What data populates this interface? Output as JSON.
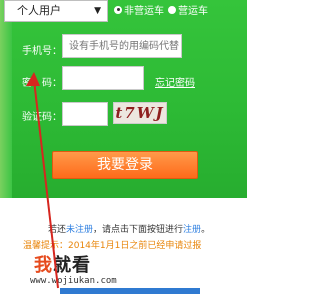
{
  "login": {
    "user_type": "个人用户",
    "radio_options": [
      {
        "label": "非营运车",
        "checked": true
      },
      {
        "label": "营运车",
        "checked": false
      }
    ],
    "phone_label": "手机号：",
    "phone_placeholder": "设有手机号的用编码代替",
    "password_label": "密　码：",
    "forgot_label": "忘记密码",
    "captcha_label": "验证码：",
    "captcha_text": "t7WJ",
    "submit_label": "我要登录"
  },
  "notice": {
    "register_pre": "若还",
    "register_em1": "未注册",
    "register_mid": "，请点击下面按钮进行",
    "register_em2": "注册",
    "register_post": "。",
    "hint": "温馨提示：2014年1月1日之前已经申请过报"
  },
  "watermark": {
    "brand_part1": "我",
    "brand_part2": "就看",
    "url": "www.wojiukan.com"
  },
  "colors": {
    "panel_green": "#2dba35",
    "button_orange": "#ff7a2a",
    "arrow_red": "#d6261f",
    "hint_orange": "#e8850a",
    "link_blue": "#2e7fe0"
  }
}
